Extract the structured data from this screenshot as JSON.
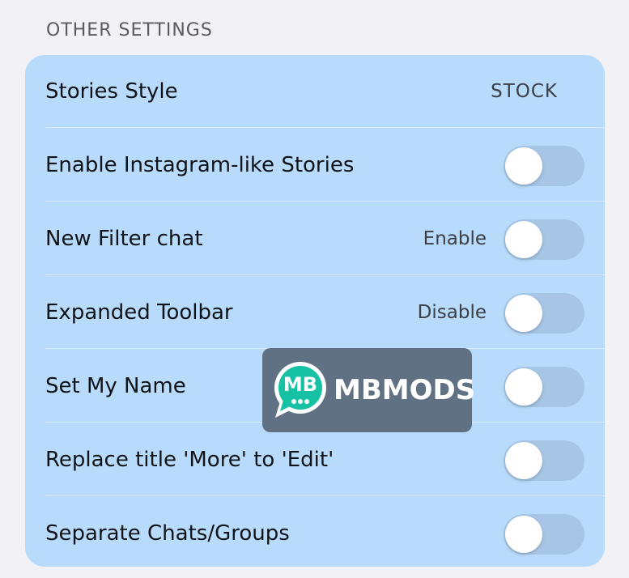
{
  "section": {
    "title": "OTHER SETTINGS"
  },
  "rows": [
    {
      "label": "Stories Style",
      "value": "STOCK"
    },
    {
      "label": "Enable Instagram-like Stories",
      "toggle": false
    },
    {
      "label": "New Filter chat",
      "hint": "Enable",
      "toggle": false
    },
    {
      "label": "Expanded Toolbar",
      "hint": "Disable",
      "toggle": false
    },
    {
      "label": "Set My Name",
      "toggle": false
    },
    {
      "label": "Replace title 'More' to 'Edit'",
      "toggle": false
    },
    {
      "label": "Separate Chats/Groups",
      "toggle": false
    }
  ],
  "watermark": {
    "logo_text": "MB",
    "brand": "MBMODS",
    "logo_color": "#16c2a3"
  },
  "colors": {
    "background": "#f2f1f6",
    "card": "#b9dbfb",
    "toggle_off_track": "#a7c6e6",
    "knob": "#ffffff"
  }
}
